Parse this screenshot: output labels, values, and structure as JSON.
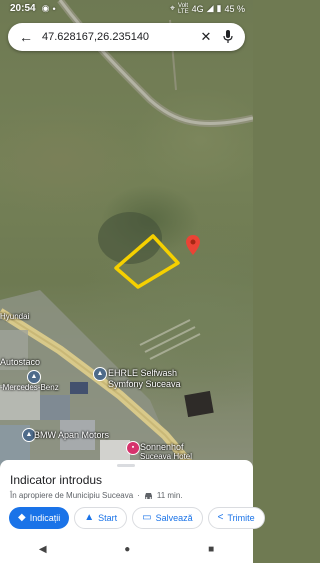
{
  "status_bar": {
    "time": "20:54",
    "net_top": "Volt",
    "net_bottom": "LTE",
    "network": "4G",
    "battery": "45 %"
  },
  "search": {
    "query": "47.628167,26.235140"
  },
  "map_labels": {
    "selfwash_1": "EHRLE Selfwash",
    "selfwash_2": "Symfony Suceava",
    "bmw": "BMW Apan Motors",
    "hotel_1": "Sonnenhof",
    "hotel_2": "Suceava Hotel",
    "mercedes_1": "Autostaco",
    "mercedes_2": "-Mercedes-Benz",
    "hyundai": "Hyundai"
  },
  "sheet": {
    "title": "Indicator introdus",
    "subtitle_place": "În apropiere de Municipiu Suceava",
    "separator": "·",
    "drive_time": "11 min."
  },
  "actions": [
    {
      "label": "Indicații",
      "icon": "directions-icon"
    },
    {
      "label": "Start",
      "icon": "navigation-icon"
    },
    {
      "label": "Salvează",
      "icon": "bookmark-icon"
    },
    {
      "label": "Trimite",
      "icon": "share-icon"
    }
  ],
  "colors": {
    "accent": "#1a73e8",
    "polygon": "#f5d000",
    "pin": "#ea4335"
  }
}
